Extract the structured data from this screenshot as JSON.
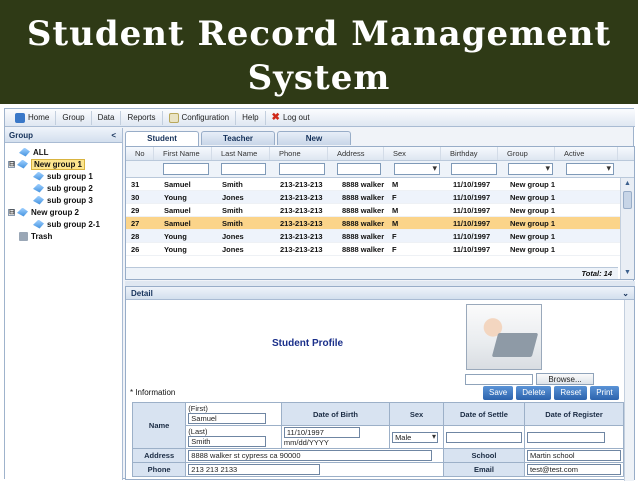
{
  "banner": {
    "line1": "Student Record Management",
    "line2": "System"
  },
  "toolbar": {
    "home": "Home",
    "group": "Group",
    "data": "Data",
    "reports": "Reports",
    "configuration": "Configuration",
    "help": "Help",
    "logout": "Log out"
  },
  "sidebar": {
    "title": "Group",
    "collapse": "<",
    "tree": [
      {
        "label": "ALL"
      },
      {
        "label": "New group 1",
        "expander": "⊟"
      },
      {
        "label": "sub group 1"
      },
      {
        "label": "sub group 2"
      },
      {
        "label": "sub group 3"
      },
      {
        "label": "New group 2",
        "expander": "⊟"
      },
      {
        "label": "sub group 2-1"
      },
      {
        "label": "Trash"
      }
    ]
  },
  "tabs": [
    "Student",
    "Teacher",
    "New"
  ],
  "grid": {
    "columns": [
      "No",
      "First Name",
      "Last Name",
      "Phone",
      "Address",
      "Sex",
      "Birthday",
      "Group",
      "Active"
    ],
    "rows": [
      [
        "31",
        "Samuel",
        "Smith",
        "213-213-213",
        "8888 walker",
        "M",
        "11/10/1997",
        "New group 1"
      ],
      [
        "30",
        "Young",
        "Jones",
        "213-213-213",
        "8888 walker",
        "F",
        "11/10/1997",
        "New group 1"
      ],
      [
        "29",
        "Samuel",
        "Smith",
        "213-213-213",
        "8888 walker",
        "M",
        "11/10/1997",
        "New group 1"
      ],
      [
        "27",
        "Samuel",
        "Smith",
        "213-213-213",
        "8888 walker",
        "M",
        "11/10/1997",
        "New group 1"
      ],
      [
        "28",
        "Young",
        "Jones",
        "213-213-213",
        "8888 walker",
        "F",
        "11/10/1997",
        "New group 1"
      ],
      [
        "26",
        "Young",
        "Jones",
        "213-213-213",
        "8888 walker",
        "F",
        "11/10/1997",
        "New group 1"
      ]
    ],
    "total": "Total: 14"
  },
  "detail": {
    "title": "Detail",
    "profile_title": "Student Profile",
    "browse": "Browse...",
    "info_label": "* Information",
    "buttons": {
      "save": "Save",
      "delete": "Delete",
      "reset": "Reset",
      "print": "Print"
    },
    "form": {
      "name_label": "Name",
      "first_label": "(First)",
      "first_value": "Samuel",
      "last_label": "(Last)",
      "last_value": "Smith",
      "dob_label": "Date of Birth",
      "dob_value": "11/10/1997",
      "dob_hint": "mm/dd/YYYY",
      "sex_label": "Sex",
      "sex_value": "Male",
      "settle_label": "Date of Settle",
      "register_label": "Date of Register",
      "address_label": "Address",
      "address_value": "8888 walker st cypress ca 90000",
      "school_label": "School",
      "school_value": "Martin school",
      "phone_label": "Phone",
      "phone_value": "213 213 2133",
      "email_label": "Email",
      "email_value": "test@test.com"
    }
  }
}
